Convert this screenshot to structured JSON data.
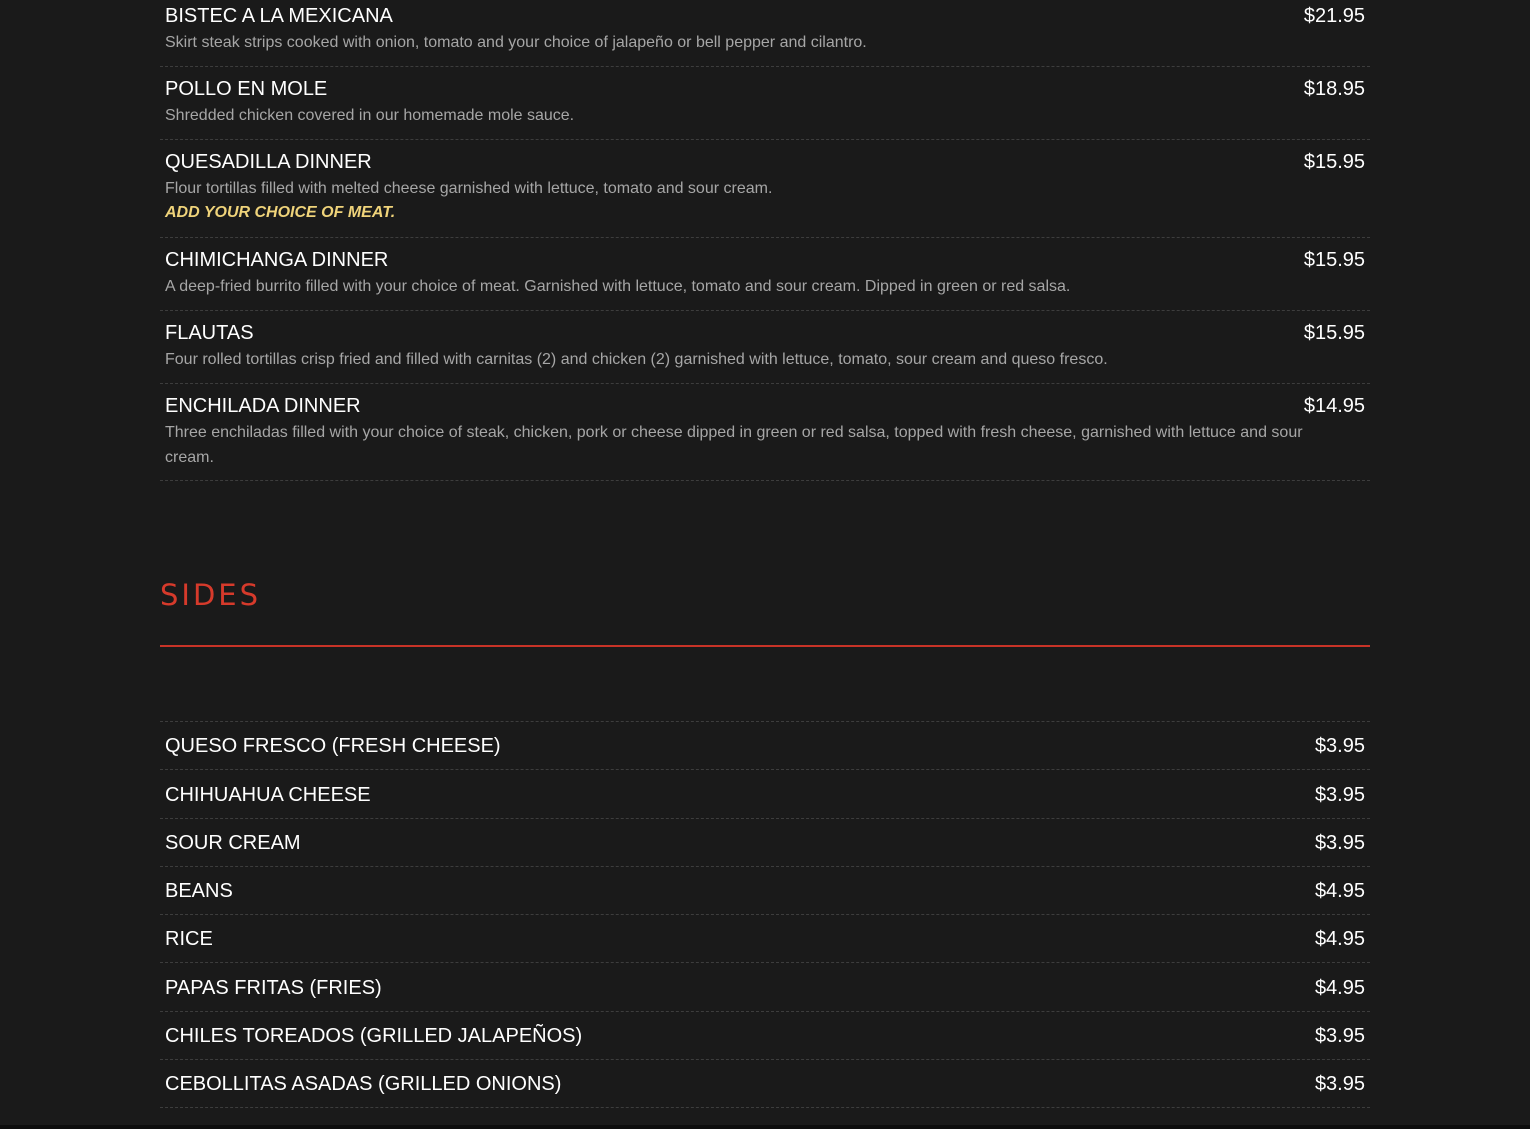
{
  "dinners": [
    {
      "name": "BISTEC A LA MEXICANA",
      "price": "$21.95",
      "desc": "Skirt steak strips cooked with onion, tomato and your choice of jalapeño or bell pepper and cilantro.",
      "note": ""
    },
    {
      "name": "POLLO EN MOLE",
      "price": "$18.95",
      "desc": "Shredded chicken covered in our homemade mole sauce.",
      "note": ""
    },
    {
      "name": "QUESADILLA DINNER",
      "price": "$15.95",
      "desc": "Flour tortillas filled with melted cheese garnished with lettuce, tomato and sour cream.",
      "note": "ADD YOUR CHOICE OF MEAT."
    },
    {
      "name": "CHIMICHANGA DINNER",
      "price": "$15.95",
      "desc": "A deep-fried burrito filled with your choice of meat. Garnished with lettuce, tomato and sour cream. Dipped in green or red salsa.",
      "note": ""
    },
    {
      "name": "FLAUTAS",
      "price": "$15.95",
      "desc": "Four rolled tortillas crisp fried and filled with carnitas (2) and chicken (2) garnished with lettuce, tomato, sour cream and queso fresco.",
      "note": ""
    },
    {
      "name": "ENCHILADA DINNER",
      "price": "$14.95",
      "desc": "Three enchiladas filled with your choice of steak, chicken, pork or cheese dipped in green or red salsa, topped with fresh cheese, garnished with lettuce and sour cream.",
      "note": ""
    }
  ],
  "sides": {
    "title": "SIDES",
    "items": [
      {
        "name": "QUESO FRESCO (FRESH CHEESE)",
        "price": "$3.95"
      },
      {
        "name": "CHIHUAHUA CHEESE",
        "price": "$3.95"
      },
      {
        "name": "SOUR CREAM",
        "price": "$3.95"
      },
      {
        "name": "BEANS",
        "price": "$4.95"
      },
      {
        "name": "RICE",
        "price": "$4.95"
      },
      {
        "name": "PAPAS FRITAS (FRIES)",
        "price": "$4.95"
      },
      {
        "name": "CHILES TOREADOS (GRILLED JALAPEÑOS)",
        "price": "$3.95"
      },
      {
        "name": "CEBOLLITAS ASADAS (GRILLED ONIONS)",
        "price": "$3.95"
      }
    ]
  },
  "colors": {
    "background": "#1a1a1a",
    "accent": "#d63a2b",
    "note": "#efd37a"
  }
}
